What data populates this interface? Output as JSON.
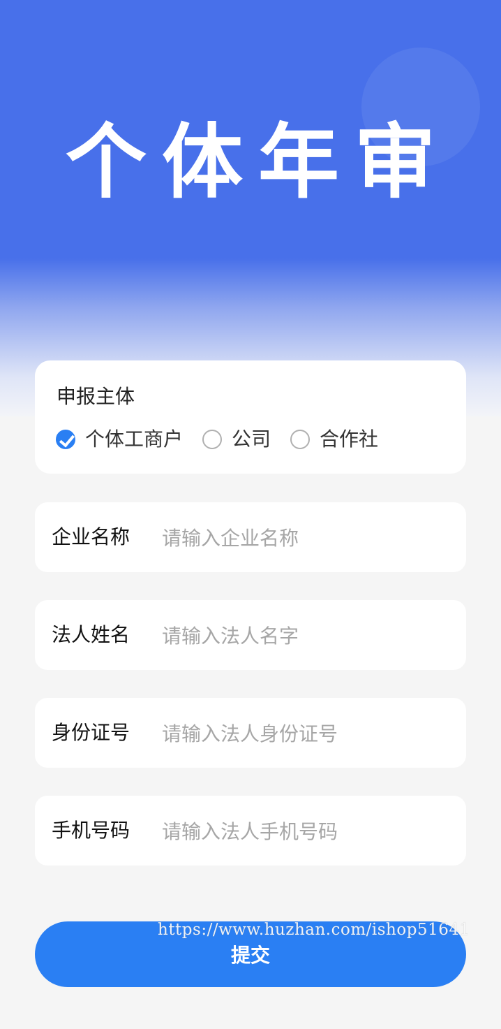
{
  "hero": {
    "title": "个体年审",
    "background_color": "#4870ea"
  },
  "subject": {
    "label": "申报主体",
    "options": [
      {
        "label": "个体工商户",
        "checked": true
      },
      {
        "label": "公司",
        "checked": false
      },
      {
        "label": "合作社",
        "checked": false
      }
    ]
  },
  "fields": [
    {
      "label": "企业名称",
      "placeholder": "请输入企业名称",
      "value": ""
    },
    {
      "label": "法人姓名",
      "placeholder": "请输入法人名字",
      "value": ""
    },
    {
      "label": "身份证号",
      "placeholder": "请输入法人身份证号",
      "value": ""
    },
    {
      "label": "手机号码",
      "placeholder": "请输入法人手机号码",
      "value": ""
    }
  ],
  "submit": {
    "label": "提交",
    "color": "#2a7ff3"
  },
  "watermark": "https://www.huzhan.com/ishop51641",
  "icons": {
    "checked": "checkmark-icon"
  }
}
